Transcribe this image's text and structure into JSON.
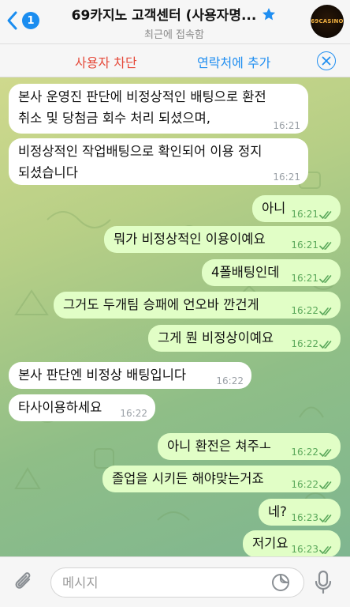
{
  "header": {
    "back_count": "1",
    "title": "69카지노 고객센터 (사용자명...",
    "subtitle": "최근에 접속함",
    "avatar_text": "69CASINO"
  },
  "action_bar": {
    "block_label": "사용자 차단",
    "add_contact_label": "연락처에 추가"
  },
  "messages": [
    {
      "dir": "in",
      "lines": [
        "본사 운영진 판단에 비정상적인 배팅으로 환전",
        "취소 및 당첨금 회수 처리 되셨으며,"
      ],
      "time": "16:21"
    },
    {
      "dir": "in",
      "lines": [
        "비정상적인 작업배팅으로 확인되어 이용 정지",
        "되셨습니다"
      ],
      "time": "16:21"
    },
    {
      "dir": "out",
      "lines": [
        "아니"
      ],
      "time": "16:21",
      "read": true
    },
    {
      "dir": "out",
      "lines": [
        "뭐가 비정상적인 이용이예요"
      ],
      "time": "16:21",
      "read": true
    },
    {
      "dir": "out",
      "lines": [
        "4폴배팅인데"
      ],
      "time": "16:21",
      "read": true
    },
    {
      "dir": "out",
      "lines": [
        "그거도 두개팀 승패에 언오바 깐건게"
      ],
      "time": "16:22",
      "read": true
    },
    {
      "dir": "out",
      "lines": [
        "그게 뭔 비정상이예요"
      ],
      "time": "16:22",
      "read": true
    },
    {
      "dir": "in",
      "lines": [
        "본사 판단엔 비정상 배팅입니다"
      ],
      "time": "16:22"
    },
    {
      "dir": "in",
      "lines": [
        "타사이용하세요"
      ],
      "time": "16:22"
    },
    {
      "dir": "out",
      "lines": [
        "아니 환전은 쳐주ㅗ"
      ],
      "time": "16:22",
      "read": true
    },
    {
      "dir": "out",
      "lines": [
        "졸업을 시키든 해야맞는거죠"
      ],
      "time": "16:22",
      "read": true
    },
    {
      "dir": "out",
      "lines": [
        "네?"
      ],
      "time": "16:23",
      "read": true
    },
    {
      "dir": "out",
      "lines": [
        "저기요"
      ],
      "time": "16:23",
      "read": true
    }
  ],
  "input": {
    "placeholder": "메시지"
  },
  "icons": {
    "back": "chevron-left-icon",
    "star": "star-icon",
    "close": "close-circle-icon",
    "attach": "paperclip-icon",
    "sticker": "sticker-icon",
    "mic": "microphone-icon",
    "read": "double-check-icon"
  },
  "colors": {
    "accent": "#1f8ef1",
    "danger": "#e5493a",
    "outgoing_bubble": "#e1fec6",
    "incoming_bubble": "#ffffff",
    "read_check": "#5aa85a"
  }
}
